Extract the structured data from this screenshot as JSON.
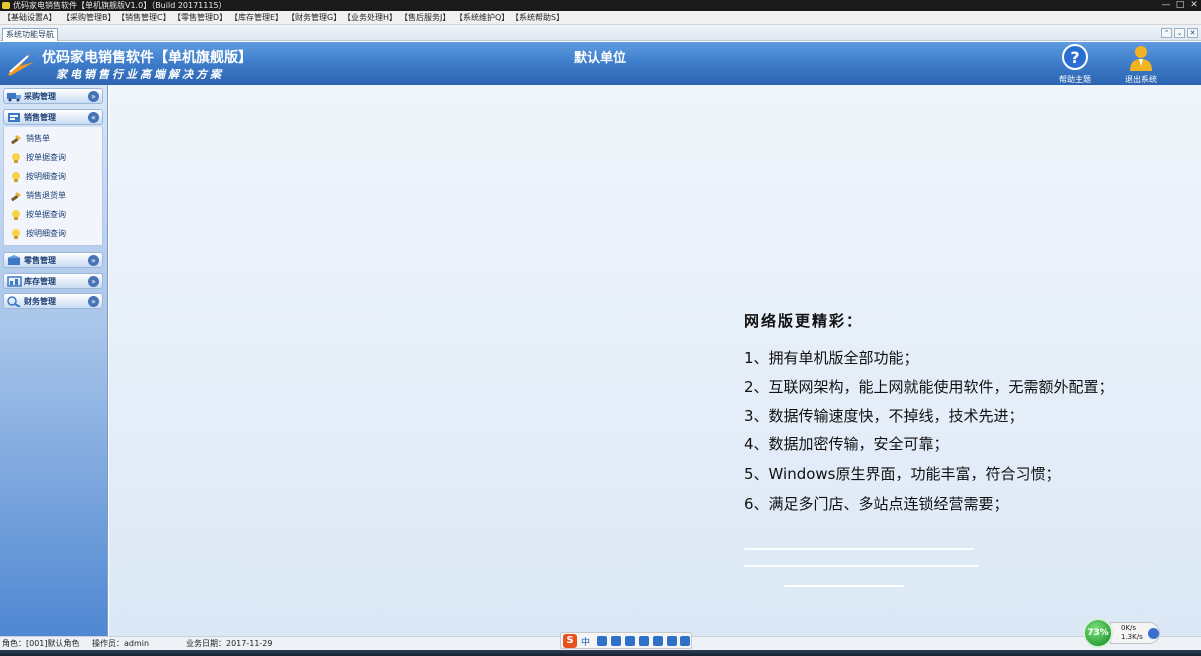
{
  "window": {
    "title": "优码家电销售软件【单机旗舰版V1.0】（Build 20171115）",
    "controls": {
      "minimize": "—",
      "maximize": "□",
      "close": "✕"
    }
  },
  "menu": {
    "items": [
      "【基础设置A】",
      "【采购管理B】",
      "【销售管理C】",
      "【零售管理D】",
      "【库存管理E】",
      "【财务管理G】",
      "【业务处理H】",
      "【售后服务J】",
      "【系统维护Q】",
      "【系统帮助S】"
    ]
  },
  "tabstrip": {
    "active_tab": "系统功能导航",
    "buttons": [
      "⌃",
      "⌄",
      "✕"
    ]
  },
  "banner": {
    "brand_title": "优码家电销售软件【单机旗舰版】",
    "slogan": "家电销售行业高端解决方案",
    "unit_name": "默认单位",
    "help_label": "帮助主题",
    "exit_label": "退出系统",
    "help_glyph": "?"
  },
  "sidebar": {
    "groups": [
      {
        "label": "采购管理",
        "chevron": "»",
        "expanded": false,
        "icon": "truck-icon"
      },
      {
        "label": "销售管理",
        "chevron": "«",
        "expanded": true,
        "icon": "sales-icon"
      },
      {
        "label": "零售管理",
        "chevron": "»",
        "expanded": false,
        "icon": "retail-icon"
      },
      {
        "label": "库存管理",
        "chevron": "»",
        "expanded": false,
        "icon": "inventory-icon"
      },
      {
        "label": "财务管理",
        "chevron": "»",
        "expanded": false,
        "icon": "finance-icon"
      }
    ],
    "sales_items": [
      {
        "label": "销售单",
        "icon": "pen-icon"
      },
      {
        "label": "按单据查询",
        "icon": "bulb-icon"
      },
      {
        "label": "按明细查询",
        "icon": "bulb-icon"
      },
      {
        "label": "销售退货单",
        "icon": "pen-icon"
      },
      {
        "label": "按单据查询",
        "icon": "bulb-icon"
      },
      {
        "label": "按明细查询",
        "icon": "bulb-icon"
      }
    ]
  },
  "promo": {
    "title": "网络版更精彩：",
    "lines": [
      "1、拥有单机版全部功能；",
      "2、互联网架构，能上网就能使用软件，无需额外配置；",
      "3、数据传输速度快，不掉线，技术先进；",
      "4、数据加密传输，安全可靠；",
      "5、Windows原生界面，功能丰富，符合习惯；",
      "6、满足多门店、多站点连锁经营需要；"
    ]
  },
  "status": {
    "role": "角色：[001]默认角色",
    "operator": "操作员：admin",
    "business_date": "业务日期：2017-11-29"
  },
  "ime": {
    "logo": "S",
    "mode": "中"
  },
  "network_widget": {
    "percent": "73%",
    "upload": "0K/s",
    "download": "1.3K/s"
  },
  "colors": {
    "banner": "#3f7fcc",
    "sidebar": "#a7c4e9",
    "main_bg": "#e6eef8",
    "accent": "#2c64b0"
  }
}
